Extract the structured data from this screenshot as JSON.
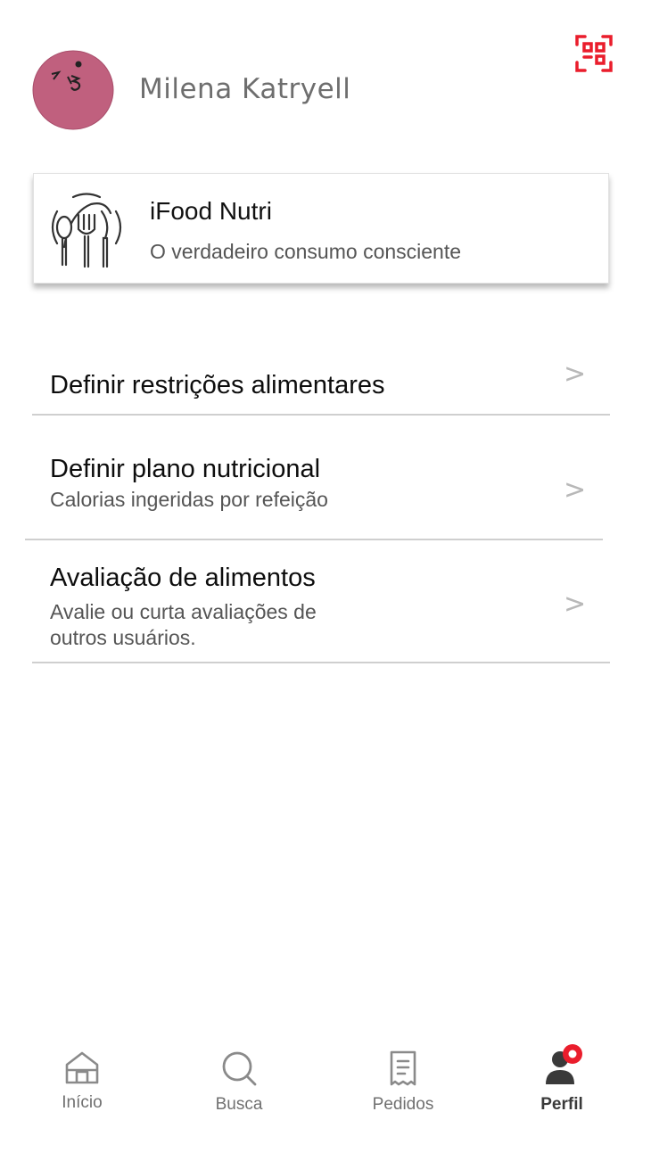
{
  "user": {
    "name": "Milena Katryell"
  },
  "colors": {
    "accent": "#ea1d2c",
    "avatar": "#c0607e"
  },
  "header": {
    "qr_icon": "qr-code-scanner-icon"
  },
  "card": {
    "icon": "plate-fork-knife-spoon-icon",
    "title": "iFood Nutri",
    "subtitle": "O verdadeiro consumo consciente"
  },
  "menu": [
    {
      "title": "Definir restrições alimentares",
      "subtitle": "",
      "chevron": ">"
    },
    {
      "title": "Definir plano nutricional",
      "subtitle": "Calorias ingeridas por refeição",
      "chevron": ">"
    },
    {
      "title": "Avaliação de alimentos",
      "subtitle": "Avalie ou curta avaliações de\noutros usuários.",
      "chevron": ">"
    }
  ],
  "nav": [
    {
      "label": "Início",
      "icon": "home-icon"
    },
    {
      "label": "Busca",
      "icon": "search-icon"
    },
    {
      "label": "Pedidos",
      "icon": "receipt-icon"
    },
    {
      "label": "Perfil",
      "icon": "profile-icon",
      "active": true
    }
  ]
}
